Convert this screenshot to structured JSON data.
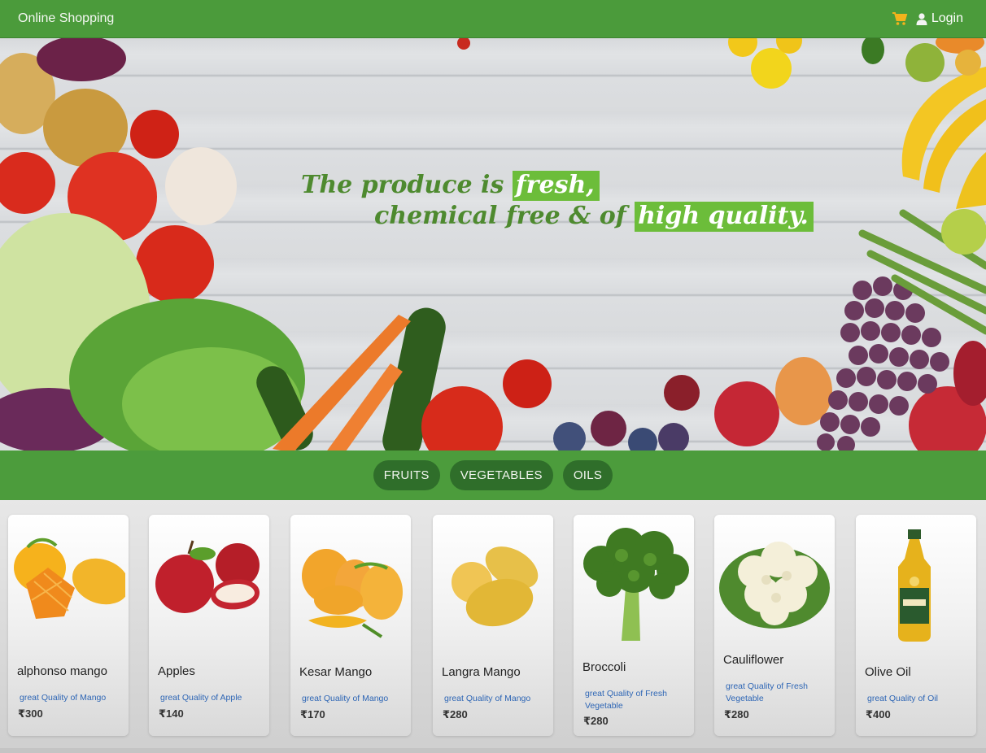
{
  "navbar": {
    "brand": "Online Shopping",
    "cart_icon": "shopping-cart-icon",
    "user_icon": "user-icon",
    "login_label": "Login",
    "bg_color": "#4b9b3b",
    "cart_color": "#f3b31c"
  },
  "hero": {
    "line1_text": "The produce is ",
    "line1_highlight": "fresh,",
    "line2_text": "chemical free & of ",
    "line2_highlight": "high quality.",
    "highlight_color": "#6cbd3a",
    "text_color": "#4e8a2f"
  },
  "categories": [
    "FRUITS",
    "VEGETABLES",
    "OILS"
  ],
  "products": [
    {
      "name": "alphonso mango",
      "desc": "great Quality of Mango",
      "price": "₹300",
      "icon": "mango-icon"
    },
    {
      "name": "Apples",
      "desc": "great Quality of Apple",
      "price": "₹140",
      "icon": "apple-icon"
    },
    {
      "name": "Kesar Mango",
      "desc": "great Quality of Mango",
      "price": "₹170",
      "icon": "mango-icon"
    },
    {
      "name": "Langra Mango",
      "desc": "great Quality of Mango",
      "price": "₹280",
      "icon": "mango-icon"
    },
    {
      "name": "Broccoli",
      "desc": "great Quality of Fresh Vegetable",
      "price": "₹280",
      "icon": "broccoli-icon"
    },
    {
      "name": "Cauliflower",
      "desc": "great Quality of Fresh Vegetable",
      "price": "₹280",
      "icon": "cauliflower-icon"
    },
    {
      "name": "Olive Oil",
      "desc": "great Quality of Oil",
      "price": "₹400",
      "icon": "olive-oil-bottle-icon"
    }
  ]
}
